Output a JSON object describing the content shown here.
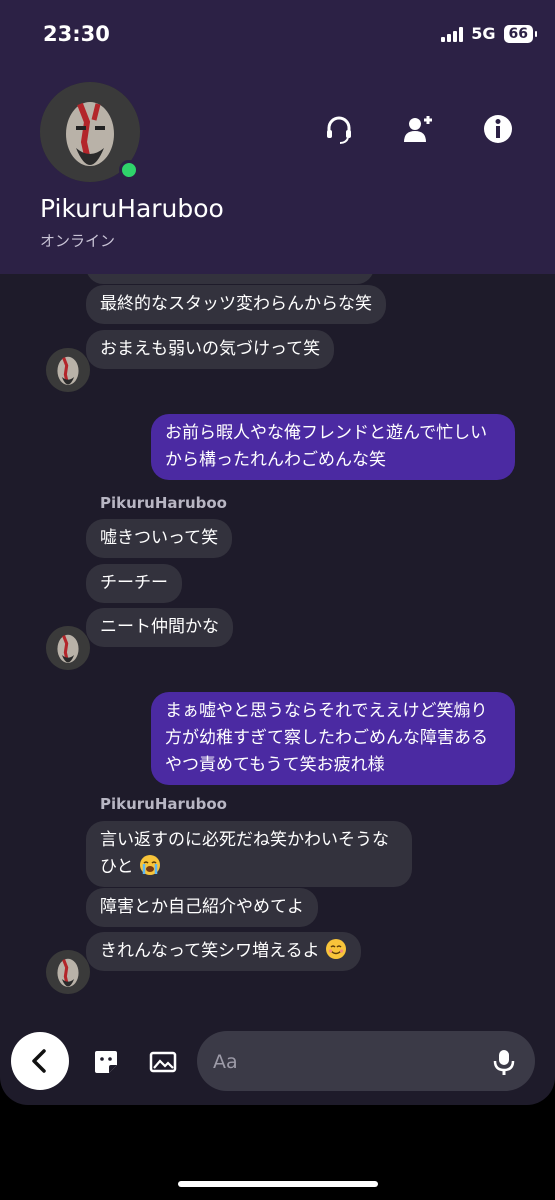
{
  "status_bar": {
    "time": "23:30",
    "network": "5G",
    "battery": "66"
  },
  "header": {
    "contact_name": "PikuruHaruboo",
    "presence": "オンライン",
    "icons": [
      "headset-icon",
      "add-person-icon",
      "info-icon"
    ]
  },
  "messages": [
    {
      "dir": "in",
      "text": "最終的なスタッツ変わらんからな笑"
    },
    {
      "dir": "in",
      "text": "おまえも弱いの気づけって笑"
    },
    {
      "dir": "out",
      "text": "お前ら暇人やな俺フレンドと遊んで忙しいから構ったれんわごめんな笑"
    },
    {
      "dir": "sender",
      "text": "PikuruHaruboo"
    },
    {
      "dir": "in",
      "text": "嘘きついって笑"
    },
    {
      "dir": "in",
      "text": "チーチー"
    },
    {
      "dir": "in",
      "text": "ニート仲間かな"
    },
    {
      "dir": "out",
      "text": "まぁ嘘やと思うならそれでええけど笑煽り方が幼稚すぎて察したわごめんな障害あるやつ責めてもうて笑お疲れ様"
    },
    {
      "dir": "sender",
      "text": "PikuruHaruboo"
    },
    {
      "dir": "in",
      "text": "言い返すのに必死だね笑かわいそうなひと",
      "emoji": "loudly-crying-face"
    },
    {
      "dir": "in",
      "text": "障害とか自己紹介やめてよ"
    },
    {
      "dir": "in",
      "text": "きれんなって笑シワ増えるよ",
      "emoji": "smiling-face"
    }
  ],
  "input_bar": {
    "placeholder": "Aa"
  },
  "colors": {
    "header_bg": "#2c2145",
    "chat_bg": "#1e1b2a",
    "incoming_bubble": "#33323d",
    "outgoing_bubble": "#4b2aa2",
    "online": "#2fd36b"
  }
}
